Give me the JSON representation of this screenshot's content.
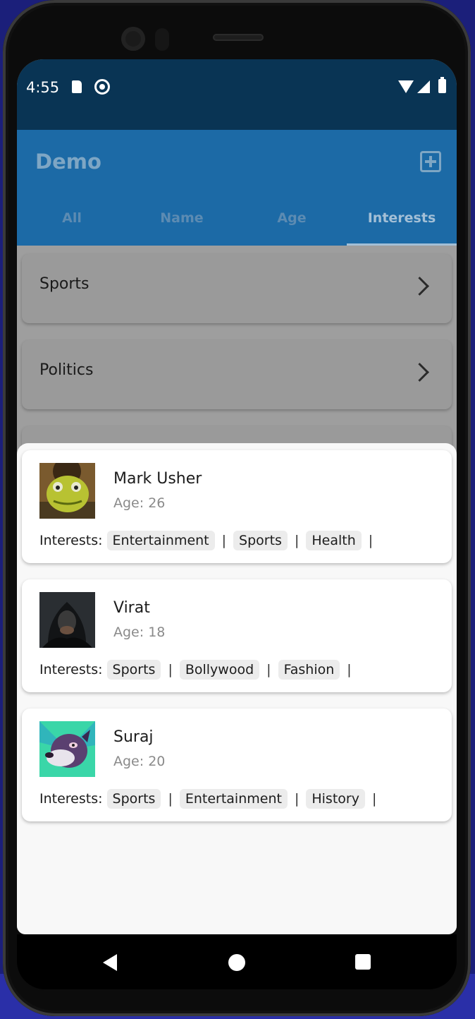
{
  "status_bar": {
    "time": "4:55"
  },
  "app_bar": {
    "title": "Demo"
  },
  "tabs": [
    {
      "label": "All"
    },
    {
      "label": "Name"
    },
    {
      "label": "Age"
    },
    {
      "label": "Interests",
      "active": true
    }
  ],
  "categories": [
    {
      "label": "Sports"
    },
    {
      "label": "Politics"
    }
  ],
  "interests_label": "Interests:",
  "separator": "|",
  "people": [
    {
      "name": "Mark Usher",
      "age": "Age: 26",
      "interests": [
        "Entertainment",
        "Sports",
        "Health"
      ],
      "avatar_icon": "frog-avatar"
    },
    {
      "name": "Virat",
      "age": "Age: 18",
      "interests": [
        "Sports",
        "Bollywood",
        "Fashion"
      ],
      "avatar_icon": "hooded-figure-avatar"
    },
    {
      "name": "Suraj",
      "age": "Age: 20",
      "interests": [
        "Sports",
        "Entertainment",
        "History"
      ],
      "avatar_icon": "dog-avatar"
    }
  ],
  "colors": {
    "status_bar": "#093454",
    "app_bar": "#1c6aa6",
    "scrim_bg": "#9e9e9e",
    "sheet_bg": "#f8f8f8"
  }
}
